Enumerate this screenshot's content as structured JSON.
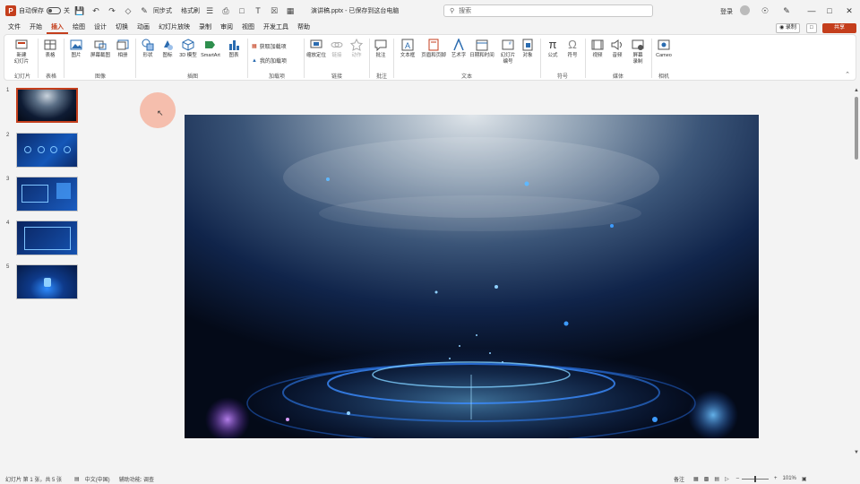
{
  "titlebar": {
    "autosave_label": "自动保存",
    "autosave_state": "关",
    "sync_label": "同步式",
    "same_format": "格式刷",
    "filename": "演讲稿.pptx - 已保存到这台电脑",
    "search_placeholder": "搜索",
    "user_label": "登录"
  },
  "menu": {
    "items": [
      "文件",
      "开始",
      "插入",
      "绘图",
      "设计",
      "切换",
      "动画",
      "幻灯片放映",
      "录制",
      "审阅",
      "视图",
      "开发工具",
      "帮助"
    ],
    "active_index": 2,
    "record_btn": "录制",
    "share_btn": "共享"
  },
  "ribbon": {
    "items": [
      {
        "label": "新建\n幻灯片"
      },
      {
        "label": "表格"
      },
      {
        "label": "图片"
      },
      {
        "label": "屏幕截图"
      },
      {
        "label": "相册"
      },
      {
        "label": "形状"
      },
      {
        "label": "图标"
      },
      {
        "label": "3D 模型"
      },
      {
        "label": "SmartArt"
      },
      {
        "label": "图表"
      },
      {
        "label": "缩放定位"
      },
      {
        "label": "链接"
      },
      {
        "label": "动作"
      },
      {
        "label": "批注"
      },
      {
        "label": "文本框"
      },
      {
        "label": "页眉和页脚"
      },
      {
        "label": "艺术字"
      },
      {
        "label": "日期和时间"
      },
      {
        "label": "幻灯片\n编号"
      },
      {
        "label": "对象"
      },
      {
        "label": "公式"
      },
      {
        "label": "符号"
      },
      {
        "label": "视频"
      },
      {
        "label": "音频"
      },
      {
        "label": "屏幕\n录制"
      },
      {
        "label": "Cameo"
      }
    ],
    "addins": [
      "获取加载项",
      "我的加载项"
    ],
    "groups": [
      "幻灯片",
      "表格",
      "图像",
      "插图",
      "加载项",
      "链接",
      "批注",
      "文本",
      "符号",
      "媒体",
      "相机"
    ]
  },
  "slides": {
    "numbers": [
      "1",
      "2",
      "3",
      "4",
      "5"
    ],
    "selected": 1
  },
  "status": {
    "slide_info": "幻灯片 第 1 张，共 5 张",
    "language": "中文(中国)",
    "accessibility": "辅助功能: 调查",
    "notes": "备注",
    "zoom": "101%"
  },
  "colors": {
    "accent": "#c43e1c",
    "stage_dark": "#0a1a36",
    "stage_blue": "#2a6fd6"
  }
}
